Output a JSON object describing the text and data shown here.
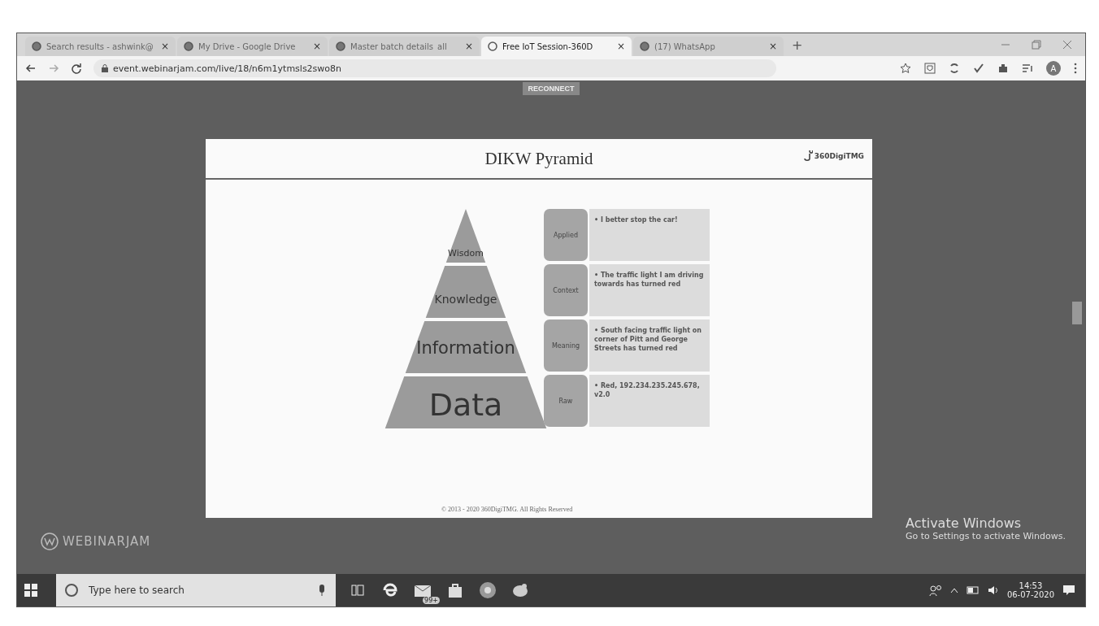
{
  "browser": {
    "tabs": [
      {
        "title": "Search results - ashwink@",
        "close": "×",
        "selected": false
      },
      {
        "title": "My Drive - Google Drive",
        "close": "×",
        "selected": false
      },
      {
        "title": "Master batch details_all_",
        "close": "×",
        "selected": false
      },
      {
        "title": "Free IoT Session-360D",
        "close": "×",
        "selected": true
      },
      {
        "title": "(17) WhatsApp",
        "close": "×",
        "selected": false
      }
    ],
    "new_tab": "+",
    "url": "event.webinarjam.com/live/18/n6m1ytmsls2swo8n",
    "profile": "A"
  },
  "webinar": {
    "reconnect": "RECONNECT",
    "brand": "WEBINARJAM",
    "slide": {
      "title": "DIKW Pyramid",
      "logo": "360DigiTMG",
      "footer": "© 2013 - 2020 360DigiTMG. All Rights Reserved",
      "levels": [
        {
          "name": "Wisdom",
          "tag": "Applied",
          "text": "• I better stop the car!"
        },
        {
          "name": "Knowledge",
          "tag": "Context",
          "text": "• The traffic light I am driving towards has turned red"
        },
        {
          "name": "Information",
          "tag": "Meaning",
          "text": "• South facing traffic light on corner of Pitt and George Streets has turned red"
        },
        {
          "name": "Data",
          "tag": "Raw",
          "text": "• Red, 192.234.235.245.678, v2.0"
        }
      ]
    }
  },
  "activation": {
    "title": "Activate Windows",
    "subtitle": "Go to Settings to activate Windows."
  },
  "taskbar": {
    "search_placeholder": "Type here to search",
    "mail_badge": "99+",
    "time": "14:53",
    "date": "06-07-2020"
  }
}
